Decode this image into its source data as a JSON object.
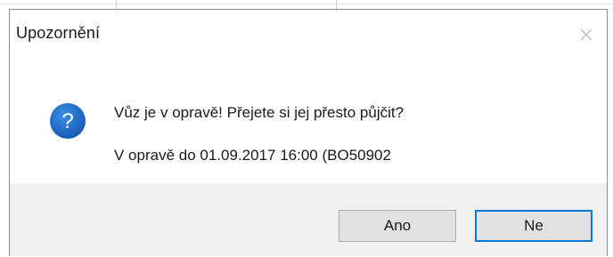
{
  "dialog": {
    "title": "Upozornění",
    "icon": "question-icon",
    "message": "Vůz je v opravě! Přejete si jej přesto půjčit?",
    "detail": "V opravě do 01.09.2017 16:00 (BO50902",
    "buttons": {
      "yes_label": "Ano",
      "no_label": "Ne",
      "default": "no"
    }
  },
  "colors": {
    "icon_blue": "#1c6bc7",
    "focus_border": "#0078d7",
    "footer_bg": "#f0f0f0",
    "button_bg": "#e1e1e1"
  }
}
